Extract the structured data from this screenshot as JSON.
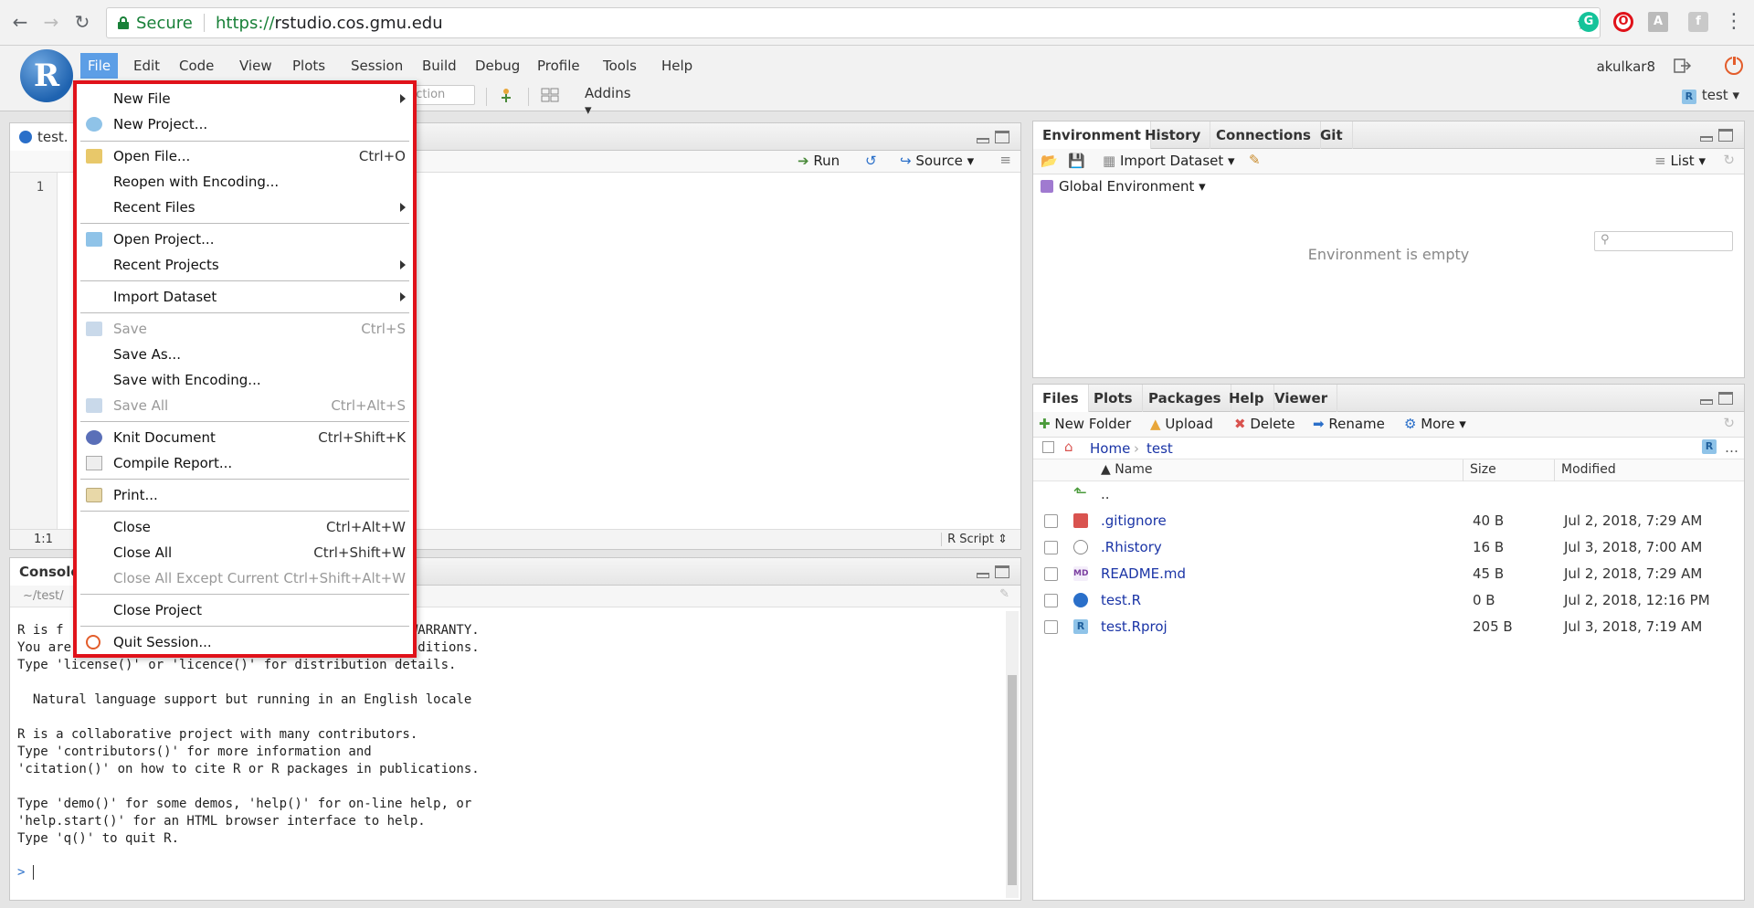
{
  "browser": {
    "secure_label": "Secure",
    "url_scheme": "https://",
    "url_host": "rstudio.cos.gmu.edu"
  },
  "rstudio": {
    "menu": [
      "File",
      "Edit",
      "Code",
      "View",
      "Plots",
      "Session",
      "Build",
      "Debug",
      "Profile",
      "Tools",
      "Help"
    ],
    "user": "akulkar8",
    "project": "test",
    "toolbar": {
      "go_to_placeholder": "nction",
      "addins": "Addins"
    }
  },
  "editor": {
    "tab_label": "test.",
    "run_label": "Run",
    "source_label": "Source",
    "line_number": "1",
    "position": "1:1",
    "file_type": "R Script"
  },
  "console": {
    "tab_label": "Console",
    "path": "~/test/",
    "lines": [
      "R is f                                          ND WARRANTY.",
      "You are welcome to redistribute it under certain conditions.",
      "Type 'license()' or 'licence()' for distribution details.",
      "",
      "  Natural language support but running in an English locale",
      "",
      "R is a collaborative project with many contributors.",
      "Type 'contributors()' for more information and",
      "'citation()' on how to cite R or R packages in publications.",
      "",
      "Type 'demo()' for some demos, 'help()' for on-line help, or",
      "'help.start()' for an HTML browser interface to help.",
      "Type 'q()' to quit R."
    ],
    "prompt": ">"
  },
  "environment": {
    "tabs": [
      "Environment",
      "History",
      "Connections",
      "Git"
    ],
    "import_dataset": "Import Dataset",
    "view_mode": "List",
    "scope": "Global Environment",
    "empty_message": "Environment is empty"
  },
  "files": {
    "tabs": [
      "Files",
      "Plots",
      "Packages",
      "Help",
      "Viewer"
    ],
    "toolbar": {
      "new_folder": "New Folder",
      "upload": "Upload",
      "delete": "Delete",
      "rename": "Rename",
      "more": "More"
    },
    "breadcrumb": {
      "home": "Home",
      "folder": "test"
    },
    "columns": {
      "name": "Name",
      "size": "Size",
      "modified": "Modified"
    },
    "parent": "..",
    "rows": [
      {
        "name": ".gitignore",
        "size": "40 B",
        "modified": "Jul 2, 2018, 7:29 AM",
        "icon_color": "#d9534f"
      },
      {
        "name": ".Rhistory",
        "size": "16 B",
        "modified": "Jul 3, 2018, 7:00 AM",
        "icon_color": "#888888"
      },
      {
        "name": "README.md",
        "size": "45 B",
        "modified": "Jul 2, 2018, 7:29 AM",
        "icon_color": "#7b3fa0"
      },
      {
        "name": "test.R",
        "size": "0 B",
        "modified": "Jul 2, 2018, 12:16 PM",
        "icon_color": "#2a6fc9"
      },
      {
        "name": "test.Rproj",
        "size": "205 B",
        "modified": "Jul 3, 2018, 7:19 AM",
        "icon_color": "#3d8fd1"
      }
    ]
  },
  "file_menu": {
    "new_file": "New File",
    "new_project": "New Project...",
    "open_file": "Open File...",
    "open_file_sc": "Ctrl+O",
    "reopen_encoding": "Reopen with Encoding...",
    "recent_files": "Recent Files",
    "open_project": "Open Project...",
    "recent_projects": "Recent Projects",
    "import_dataset": "Import Dataset",
    "save": "Save",
    "save_sc": "Ctrl+S",
    "save_as": "Save As...",
    "save_encoding": "Save with Encoding...",
    "save_all": "Save All",
    "save_all_sc": "Ctrl+Alt+S",
    "knit": "Knit Document",
    "knit_sc": "Ctrl+Shift+K",
    "compile": "Compile Report...",
    "print": "Print...",
    "close": "Close",
    "close_sc": "Ctrl+Alt+W",
    "close_all": "Close All",
    "close_all_sc": "Ctrl+Shift+W",
    "close_except": "Close All Except Current",
    "close_except_sc": "Ctrl+Shift+Alt+W",
    "close_project": "Close Project",
    "quit": "Quit Session..."
  }
}
